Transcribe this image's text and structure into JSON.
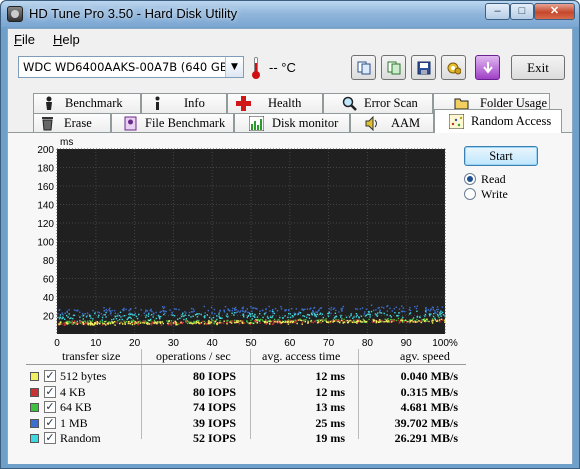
{
  "window": {
    "title": "HD Tune Pro 3.50 - Hard Disk Utility"
  },
  "menu": {
    "file": "File",
    "file_key": "F",
    "file_rest": "ile",
    "help": "Help",
    "help_key": "H",
    "help_rest": "elp"
  },
  "toolbar": {
    "drive": "WDC WD6400AAKS-00A7B (640 GB)",
    "temperature": "-- °C",
    "exit_label": "Exit",
    "buttons": [
      "copy-info-icon",
      "copy-screenshot-icon",
      "save-icon",
      "options-icon",
      "download-icon"
    ]
  },
  "tabs_top": [
    {
      "label": "Benchmark",
      "icon": "benchmark-icon"
    },
    {
      "label": "Info",
      "icon": "info-icon"
    },
    {
      "label": "Health",
      "icon": "health-icon"
    },
    {
      "label": "Error Scan",
      "icon": "error-scan-icon"
    },
    {
      "label": "Folder Usage",
      "icon": "folder-icon"
    }
  ],
  "tabs_bottom": [
    {
      "label": "Erase",
      "icon": "erase-icon"
    },
    {
      "label": "File Benchmark",
      "icon": "file-benchmark-icon"
    },
    {
      "label": "Disk monitor",
      "icon": "disk-monitor-icon"
    },
    {
      "label": "AAM",
      "icon": "speaker-icon"
    },
    {
      "label": "Random Access",
      "icon": "random-access-icon",
      "active": true
    }
  ],
  "controls": {
    "start_label": "Start",
    "mode": "Read",
    "read_label": "Read",
    "write_label": "Write"
  },
  "chart_data": {
    "type": "scatter",
    "ylabel": "ms",
    "ylim": [
      0,
      200
    ],
    "xlim": [
      0,
      100
    ],
    "yticks": [
      20,
      40,
      60,
      80,
      100,
      120,
      140,
      160,
      180,
      200
    ],
    "xticks": [
      "0",
      "10",
      "20",
      "30",
      "40",
      "50",
      "60",
      "70",
      "80",
      "90",
      "100%"
    ],
    "grid": true,
    "background": "#202020",
    "series": [
      {
        "name": "512 bytes",
        "color": "#f0f060",
        "band": [
          12,
          12
        ]
      },
      {
        "name": "4 KB",
        "color": "#c83232",
        "band": [
          12,
          12
        ]
      },
      {
        "name": "64 KB",
        "color": "#40c040",
        "band": [
          13,
          13
        ]
      },
      {
        "name": "1 MB",
        "color": "#3c70d0",
        "band": [
          25,
          25
        ]
      },
      {
        "name": "Random",
        "color": "#40d8e0",
        "band": [
          19,
          19
        ]
      }
    ]
  },
  "results": {
    "headers": [
      "transfer size",
      "operations / sec",
      "avg. access time",
      "agv. speed"
    ],
    "rows": [
      {
        "label": "512 bytes",
        "color": "#f0f060",
        "checked": true,
        "ops": "80 IOPS",
        "access": "12 ms",
        "speed": "0.040 MB/s"
      },
      {
        "label": "4 KB",
        "color": "#c83232",
        "checked": true,
        "ops": "80 IOPS",
        "access": "12 ms",
        "speed": "0.315 MB/s"
      },
      {
        "label": "64 KB",
        "color": "#40c040",
        "checked": true,
        "ops": "74 IOPS",
        "access": "13 ms",
        "speed": "4.681 MB/s"
      },
      {
        "label": "1 MB",
        "color": "#3c70d0",
        "checked": true,
        "ops": "39 IOPS",
        "access": "25 ms",
        "speed": "39.702 MB/s"
      },
      {
        "label": "Random",
        "color": "#40d8e0",
        "checked": true,
        "ops": "52 IOPS",
        "access": "19 ms",
        "speed": "26.291 MB/s"
      }
    ]
  }
}
